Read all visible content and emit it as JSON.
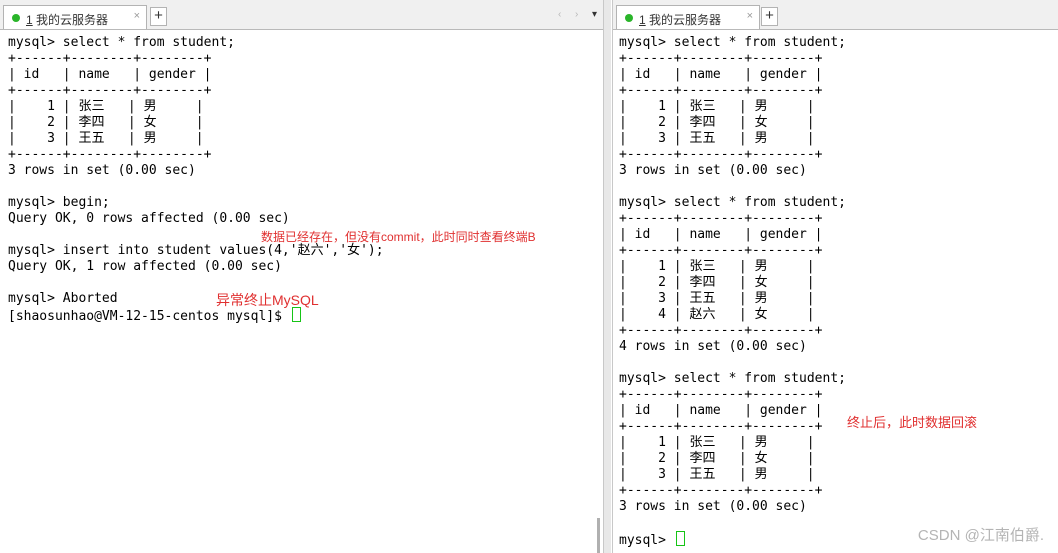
{
  "left_pane": {
    "tab": {
      "number": "1",
      "title": "我的云服务器",
      "close": "×"
    },
    "new_tab": "+",
    "nav": [
      "‹",
      "›",
      "▾"
    ],
    "lines": [
      "mysql> select * from student;",
      "+------+--------+--------+",
      "| id   | name   | gender |",
      "+------+--------+--------+",
      "|    1 | 张三   | 男     |",
      "|    2 | 李四   | 女     |",
      "|    3 | 王五   | 男     |",
      "+------+--------+--------+",
      "3 rows in set (0.00 sec)",
      "",
      "mysql> begin;",
      "Query OK, 0 rows affected (0.00 sec)",
      "",
      "mysql> insert into student values(4,'赵六','女');",
      "Query OK, 1 row affected (0.00 sec)",
      "",
      "mysql> Aborted",
      "[shaosunhao@VM-12-15-centos mysql]$ "
    ],
    "annotations": {
      "commit_note": "数据已经存在，但没有commit，此时同时查看终端B",
      "abort_note": "异常终止MySQL"
    }
  },
  "right_pane": {
    "tab": {
      "number": "1",
      "title": "我的云服务器",
      "close": "×"
    },
    "new_tab": "+",
    "lines": [
      "mysql> select * from student;",
      "+------+--------+--------+",
      "| id   | name   | gender |",
      "+------+--------+--------+",
      "|    1 | 张三   | 男     |",
      "|    2 | 李四   | 女     |",
      "|    3 | 王五   | 男     |",
      "+------+--------+--------+",
      "3 rows in set (0.00 sec)",
      "",
      "mysql> select * from student;",
      "+------+--------+--------+",
      "| id   | name   | gender |",
      "+------+--------+--------+",
      "|    1 | 张三   | 男     |",
      "|    2 | 李四   | 女     |",
      "|    3 | 王五   | 男     |",
      "|    4 | 赵六   | 女     |",
      "+------+--------+--------+",
      "4 rows in set (0.00 sec)",
      "",
      "mysql> select * from student;",
      "+------+--------+--------+",
      "| id   | name   | gender |",
      "+------+--------+--------+",
      "|    1 | 张三   | 男     |",
      "|    2 | 李四   | 女     |",
      "|    3 | 王五   | 男     |",
      "+------+--------+--------+",
      "3 rows in set (0.00 sec)",
      "",
      "mysql> "
    ],
    "annotations": {
      "rollback_note": "终止后，此时数据回滚"
    }
  },
  "watermark": "CSDN @江南伯爵.",
  "colors": {
    "annotation": "#e03030",
    "status_dot": "#2ab52a",
    "cursor": "#16c416"
  },
  "icons": {
    "tab_status": "green-dot-icon",
    "new_tab": "plus-icon",
    "close": "close-icon"
  }
}
